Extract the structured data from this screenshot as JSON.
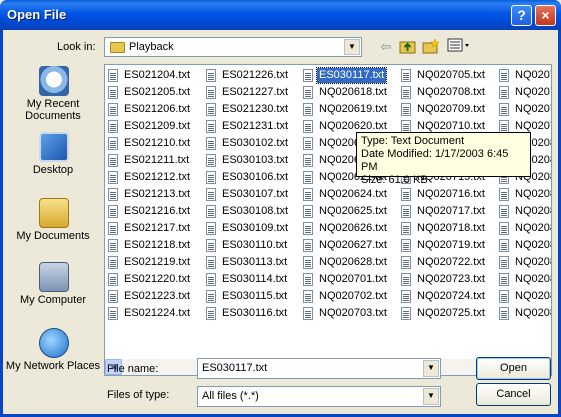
{
  "window": {
    "title": "Open File",
    "help_label": "?",
    "close_label": "×"
  },
  "toolbar": {
    "look_in_label": "Look in:",
    "look_in_value": "Playback",
    "back_icon": "back-arrow-icon",
    "up_icon": "folder-up-icon",
    "new_folder_icon": "new-folder-icon",
    "view_icon": "view-menu-icon"
  },
  "places": [
    {
      "label": "My Recent Documents",
      "icon": "recent-documents-icon"
    },
    {
      "label": "Desktop",
      "icon": "desktop-icon"
    },
    {
      "label": "My Documents",
      "icon": "my-documents-icon"
    },
    {
      "label": "My Computer",
      "icon": "my-computer-icon"
    },
    {
      "label": "My Network Places",
      "icon": "network-places-icon"
    }
  ],
  "files": {
    "columns": [
      [
        "ES021204.txt",
        "ES021205.txt",
        "ES021206.txt",
        "ES021209.txt",
        "ES021210.txt",
        "ES021211.txt",
        "ES021212.txt",
        "ES021213.txt",
        "ES021216.txt",
        "ES021217.txt",
        "ES021218.txt",
        "ES021219.txt",
        "ES021220.txt",
        "ES021223.txt",
        "ES021224.txt"
      ],
      [
        "ES021226.txt",
        "ES021227.txt",
        "ES021230.txt",
        "ES021231.txt",
        "ES030102.txt",
        "ES030103.txt",
        "ES030106.txt",
        "ES030107.txt",
        "ES030108.txt",
        "ES030109.txt",
        "ES030110.txt",
        "ES030113.txt",
        "ES030114.txt",
        "ES030115.txt",
        "ES030116.txt"
      ],
      [
        "ES030117.txt",
        "NQ020618.txt",
        "NQ020619.txt",
        "NQ020620.txt",
        "NQ020620.txt",
        "NQ020620.txt",
        "NQ020621.txt",
        "NQ020624.txt",
        "NQ020625.txt",
        "NQ020626.txt",
        "NQ020627.txt",
        "NQ020628.txt",
        "NQ020701.txt",
        "NQ020702.txt",
        "NQ020703.txt"
      ],
      [
        "NQ020705.txt",
        "NQ020708.txt",
        "NQ020709.txt",
        "NQ020710.txt",
        "NQ020711.txt",
        "NQ020712.txt",
        "NQ020715.txt",
        "NQ020716.txt",
        "NQ020717.txt",
        "NQ020718.txt",
        "NQ020719.txt",
        "NQ020722.txt",
        "NQ020723.txt",
        "NQ020724.txt",
        "NQ020725.txt"
      ],
      [
        "NQ0207",
        "NQ0207",
        "NQ0207",
        "NQ0207",
        "NQ0208",
        "NQ0208",
        "NQ0208",
        "NQ0208",
        "NQ0208",
        "NQ0208",
        "NQ0208",
        "NQ0208",
        "NQ0208",
        "NQ0208",
        "NQ0208"
      ]
    ],
    "selected": "ES030117.txt"
  },
  "tooltip": {
    "line1": "Type: Text Document",
    "line2": "Date Modified: 1/17/2003 6:45 PM",
    "line3": "Size: 61.0 KB"
  },
  "footer": {
    "file_name_label": "File name:",
    "file_name_value": "ES030117.txt",
    "files_of_type_label": "Files of type:",
    "files_of_type_value": "All files (*.*)",
    "open_label": "Open",
    "cancel_label": "Cancel"
  }
}
